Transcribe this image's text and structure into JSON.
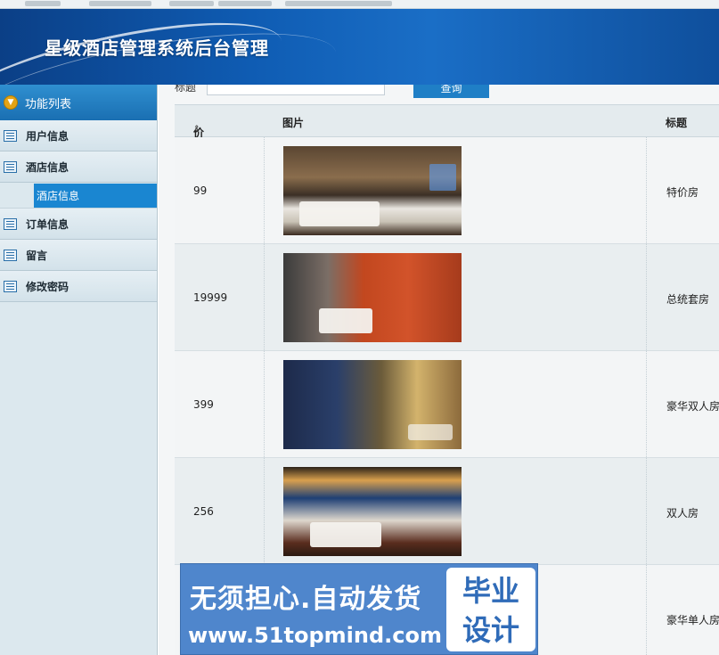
{
  "header": {
    "title": "星级酒店管理系统后台管理"
  },
  "sidebar": {
    "heading": "功能列表",
    "items": [
      {
        "label": "用户信息"
      },
      {
        "label": "酒店信息"
      },
      {
        "label": "酒店信息",
        "active": true,
        "sub": true
      },
      {
        "label": "订单信息"
      },
      {
        "label": "留言"
      },
      {
        "label": "修改密码"
      }
    ]
  },
  "search": {
    "label": "标题",
    "button": "查询",
    "input_value": ""
  },
  "table": {
    "columns": {
      "price": "价格",
      "image": "图片",
      "title": "标题"
    },
    "rows": [
      {
        "price": "99",
        "title": "特价房"
      },
      {
        "price": "19999",
        "title": "总统套房"
      },
      {
        "price": "399",
        "title": "豪华双人房"
      },
      {
        "price": "256",
        "title": "双人房"
      },
      {
        "price": "",
        "title": "豪华单人房"
      }
    ]
  },
  "watermark": {
    "line1": "无须担心.自动发货",
    "line2": "www.51topmind.com",
    "badge_line1": "毕业",
    "badge_line2": "设计"
  }
}
